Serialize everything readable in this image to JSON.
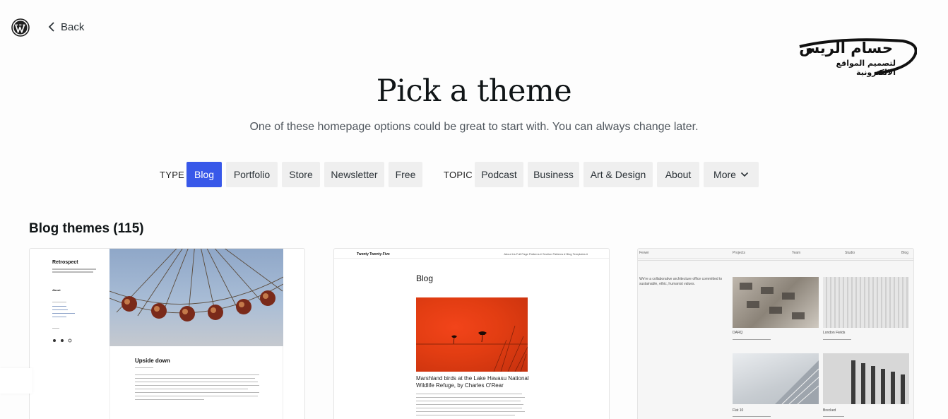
{
  "header": {
    "logo_icon": "wordpress-logo-icon",
    "back_label": "Back",
    "brand_line1": "حسام الريس",
    "brand_line2": "لتصميم المواقع الالكترونية"
  },
  "page": {
    "title": "Pick a theme",
    "subtitle": "One of these homepage options could be great to start with. You can always change later."
  },
  "filters": {
    "type_label": "TYPE",
    "type_options": [
      "Blog",
      "Portfolio",
      "Store",
      "Newsletter",
      "Free"
    ],
    "active_type": "Blog",
    "topic_label": "TOPIC",
    "topic_options": [
      "Podcast",
      "Business",
      "Art & Design",
      "About"
    ],
    "more_label": "More"
  },
  "section": {
    "title": "Blog themes (115)"
  },
  "themes": [
    {
      "site_name": "Retrospect",
      "nav_item": "About",
      "post_title": "Upside down"
    },
    {
      "brand": "Twenty Twenty-Five",
      "nav": "About Us   Full Page Patterns ▾   Section Patterns ▾   Blog Templates ▾",
      "heading": "Blog",
      "caption": "Marshland birds at the Lake Havasu National Wildlife Refuge, by Charles O'Rear"
    },
    {
      "nav": [
        "Fewer",
        "Projects",
        "Team",
        "Studio",
        "Blog"
      ],
      "intro": "We're a collaborative architecture office committed to sustainable, ethic, humanist values.",
      "projects": [
        "DARQ",
        "London Fields",
        "Flat 10",
        "Brecked"
      ]
    }
  ],
  "colors": {
    "accent": "#3858e9",
    "chip_bg": "#efefef",
    "text_primary": "#101517",
    "text_secondary": "#50575e"
  }
}
